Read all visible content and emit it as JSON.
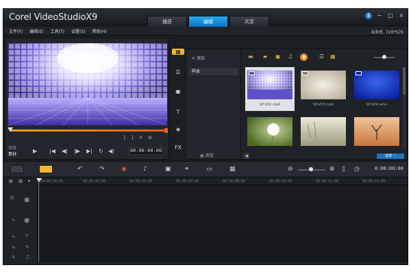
{
  "app": {
    "logo_brand": "Corel",
    "logo_product": "VideoStudio",
    "logo_version": "X9"
  },
  "tabs": [
    {
      "label": "捕获",
      "active": false
    },
    {
      "label": "编辑",
      "active": true
    },
    {
      "label": "共享",
      "active": false
    }
  ],
  "window_controls": {
    "info": "i",
    "minimize": "−",
    "maximize": "□",
    "close": "×"
  },
  "menu": [
    "文件(F)",
    "编辑(E)",
    "工具(T)",
    "设置(S)",
    "帮助(H)"
  ],
  "project": {
    "name_label": "未命名, 720*576"
  },
  "player": {
    "mode_project": "项目",
    "mode_clip": "素材",
    "active_mode": "素材",
    "timecode": "00:00:00:00",
    "mark_in": "[",
    "mark_out": "]",
    "controls": {
      "play": "▶",
      "home": "|◀",
      "prev": "◀|",
      "next": "|▶",
      "end": "▶|",
      "repeat": "↻",
      "volume": "◀)"
    }
  },
  "instrument_bar": {
    "media": "▦",
    "instant_project": "☰",
    "transition": "▣",
    "title": "T",
    "graphic": "❖",
    "fx": "FX"
  },
  "library": {
    "add_label": "添加",
    "folder_label": "样本",
    "browse_label": "浏览",
    "options_label": "选项",
    "thumbnails": [
      {
        "label": "SP-V02.mp4",
        "selected": true
      },
      {
        "label": "SP-V03.mp4",
        "selected": false
      },
      {
        "label": "SP-V04.wmv",
        "selected": false
      },
      {
        "label": "",
        "selected": false
      },
      {
        "label": "",
        "selected": false
      },
      {
        "label": "",
        "selected": false
      }
    ]
  },
  "timeline": {
    "time_display": "0:00:00:00",
    "ruler_ticks": [
      "00:00:00:00",
      "00:00:02:00",
      "00:00:04:00",
      "00:00:06:00",
      "00:00:08:00",
      "00:00:10:00",
      "00:00:12:00",
      "00:00:14:00"
    ]
  }
}
